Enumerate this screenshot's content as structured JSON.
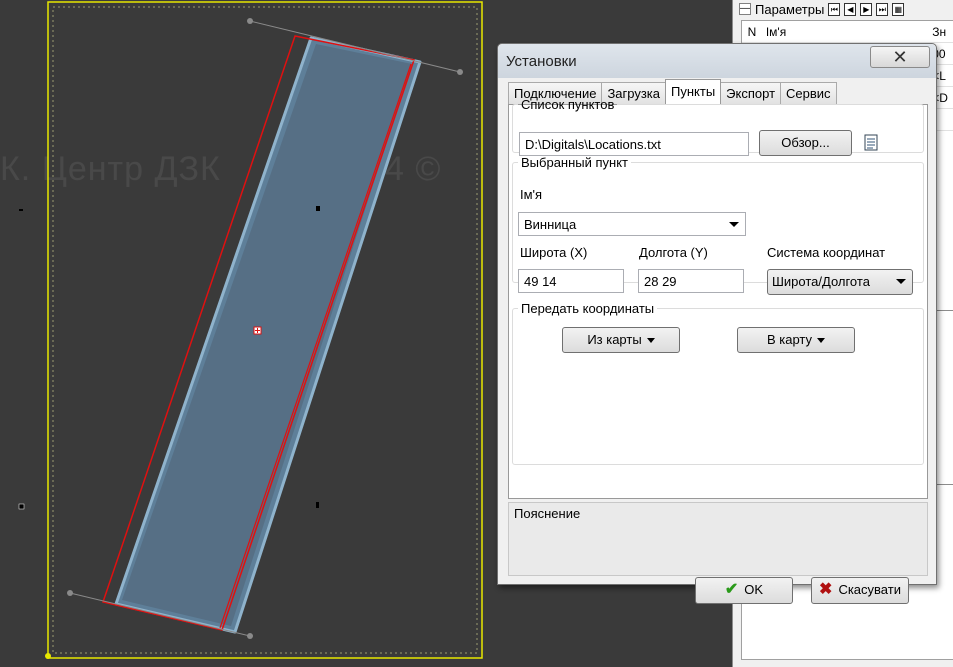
{
  "canvas": {
    "watermark": "К. Центр ДЗК          2014 ©"
  },
  "side_panel": {
    "title": "Параметры",
    "collapse_symbol": "—",
    "nav_buttons": [
      "⏮",
      "◀",
      "▶",
      "⏭",
      "▦"
    ],
    "columns": [
      "N",
      "Ім'я",
      "Зн"
    ],
    "rows": [
      {
        "n": "",
        "name": "",
        "value": "00"
      },
      {
        "n": "",
        "name": "",
        "value": "<L"
      },
      {
        "n": "",
        "name": "",
        "value": "<D"
      },
      {
        "n": "+",
        "name": "",
        "value": ""
      }
    ]
  },
  "dialog": {
    "title": "Установки",
    "close_symbol": "✕",
    "tabs": [
      "Подключение",
      "Загрузка",
      "Пункты",
      "Экспорт",
      "Сервис"
    ],
    "active_tab": "Пункты",
    "points_list": {
      "legend": "Список пунктов",
      "path": "D:\\Digitals\\Locations.txt",
      "browse_label": "Обзор..."
    },
    "selected_point": {
      "legend": "Выбранный пункт",
      "name_label": "Ім'я",
      "name_value": "Винница",
      "lat_label": "Широта (X)",
      "lat_value": "49 14",
      "lon_label": "Долгота (Y)",
      "lon_value": "28 29",
      "crs_label": "Система координат",
      "crs_value": "Широта/Долгота"
    },
    "transfer": {
      "legend": "Передать координаты",
      "from_map_label": "Из карты",
      "to_map_label": "В карту"
    },
    "note_label": "Пояснение",
    "ok_label": "OK",
    "cancel_label": "Скасувати",
    "ok_symbol": "✔",
    "cancel_symbol": "✖"
  }
}
